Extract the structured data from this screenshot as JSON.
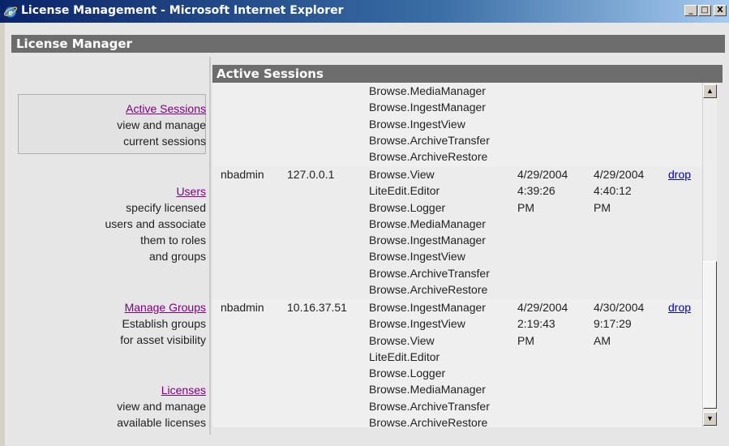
{
  "window": {
    "title": "License Management - Microsoft Internet Explorer",
    "buttons": {
      "minimize": "_",
      "maximize": "□",
      "close": "X"
    }
  },
  "app": {
    "header": "License Manager"
  },
  "nav": [
    {
      "label": "Active Sessions",
      "desc": [
        "view and manage",
        "current sessions"
      ],
      "selected": true
    },
    {
      "label": "Users",
      "desc": [
        "specify licensed",
        "users and associate",
        "them to roles",
        "and groups"
      ]
    },
    {
      "label": "Manage Groups",
      "desc": [
        "Establish groups",
        "for asset visibility"
      ]
    },
    {
      "label": "Licenses",
      "desc": [
        "view and manage",
        "available licenses"
      ]
    }
  ],
  "panel": {
    "title": "Active Sessions"
  },
  "sessions": [
    {
      "user": "",
      "ip": "",
      "licenses": [
        "Browse.MediaManager",
        "Browse.IngestManager",
        "Browse.IngestView",
        "Browse.ArchiveTransfer",
        "Browse.ArchiveRestore"
      ],
      "start": [],
      "last": [],
      "action": ""
    },
    {
      "user": "nbadmin",
      "ip": "127.0.0.1",
      "licenses": [
        "Browse.View",
        "LiteEdit.Editor",
        "Browse.Logger",
        "Browse.MediaManager",
        "Browse.IngestManager",
        "Browse.IngestView",
        "Browse.ArchiveTransfer",
        "Browse.ArchiveRestore"
      ],
      "start": [
        "4/29/2004",
        "4:39:26",
        "PM"
      ],
      "last": [
        "4/29/2004",
        "4:40:12",
        "PM"
      ],
      "action": "drop"
    },
    {
      "user": "nbadmin",
      "ip": "10.16.37.51",
      "licenses": [
        "Browse.IngestManager",
        "Browse.IngestView",
        "Browse.View",
        "LiteEdit.Editor",
        "Browse.Logger",
        "Browse.MediaManager",
        "Browse.ArchiveTransfer",
        "Browse.ArchiveRestore"
      ],
      "start": [
        "4/29/2004",
        "2:19:43",
        "PM"
      ],
      "last": [
        "4/30/2004",
        "9:17:29",
        "AM"
      ],
      "action": "drop"
    }
  ],
  "scroll": {
    "up_arrow": "▲",
    "down_arrow": "▼"
  }
}
